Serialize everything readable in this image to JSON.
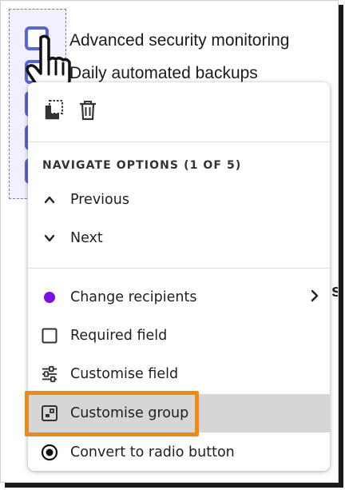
{
  "checkboxes": [
    {
      "label": "Advanced security monitoring"
    },
    {
      "label": "Daily automated backups"
    }
  ],
  "toolbar": {
    "icons": [
      "copy-icon",
      "trash-icon"
    ]
  },
  "navigate": {
    "title": "NAVIGATE OPTIONS (1 OF 5)",
    "previous_label": "Previous",
    "next_label": "Next"
  },
  "menu_items": [
    {
      "label": "Change recipients",
      "icon": "purple-dot-icon",
      "has_submenu": true,
      "dot_color": "#7b10e0"
    },
    {
      "label": "Required field",
      "icon": "checkbox-icon"
    },
    {
      "label": "Customise field",
      "icon": "sliders-icon"
    },
    {
      "label": "Customise group",
      "icon": "group-icon",
      "highlighted": true
    },
    {
      "label": "Convert to radio button",
      "icon": "radio-icon"
    }
  ],
  "colors": {
    "highlight": "#f08a16",
    "checkbox_border": "#5865d8"
  }
}
